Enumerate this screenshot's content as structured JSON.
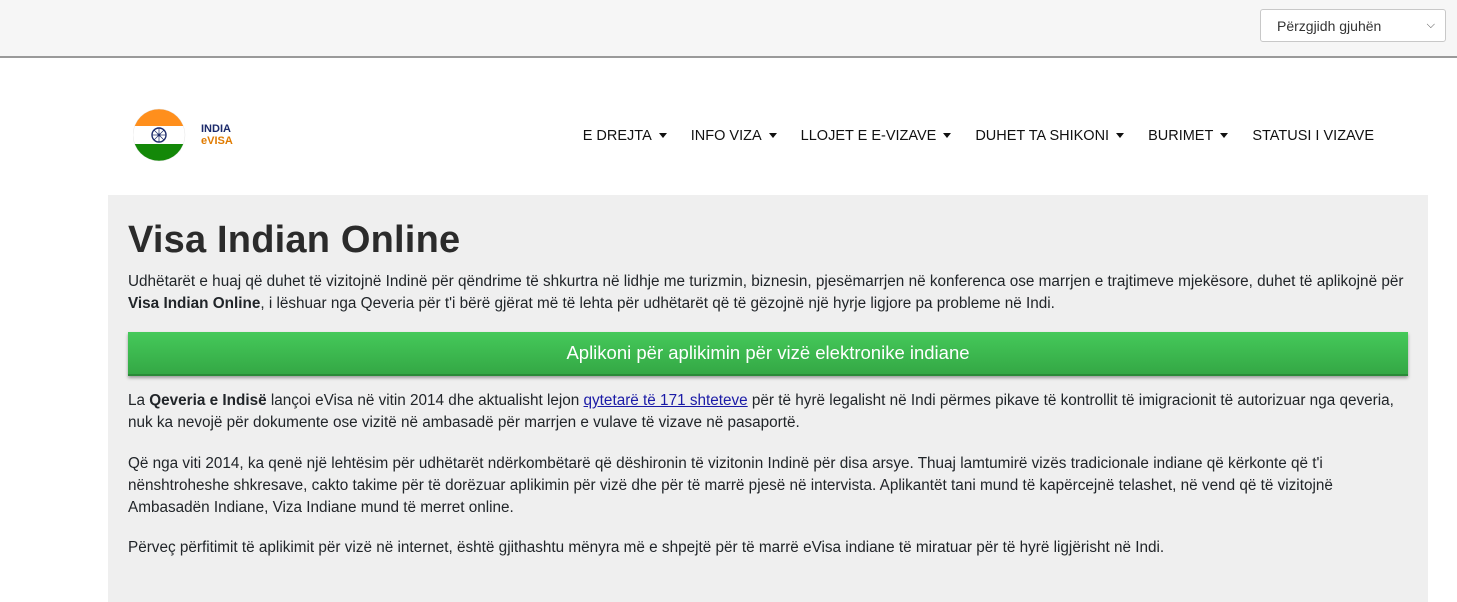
{
  "topbar": {
    "language_select": "Përzgjidh gjuhën"
  },
  "logo": {
    "line1": "INDIA",
    "line2": "eVISA",
    "flag_colors": {
      "saffron": "#ff8f1c",
      "white": "#ffffff",
      "green": "#138808",
      "chakra": "#1c2b6b"
    }
  },
  "nav": {
    "items": [
      {
        "label": "E DREJTA",
        "dropdown": true
      },
      {
        "label": "INFO VIZA",
        "dropdown": true
      },
      {
        "label": "LLOJET E E-VIZAVE",
        "dropdown": true
      },
      {
        "label": "DUHET TA SHIKONI",
        "dropdown": true
      },
      {
        "label": "BURIMET",
        "dropdown": true
      },
      {
        "label": "STATUSI I VIZAVE",
        "dropdown": false
      }
    ]
  },
  "main": {
    "title": "Visa Indian Online",
    "p1_before": "Udhëtarët e huaj që duhet të vizitojnë Indinë për qëndrime të shkurtra në lidhje me turizmin, biznesin, pjesëmarrjen në konferenca ose marrjen e trajtimeve mjekësore, duhet të aplikojnë për ",
    "p1_bold": "Visa Indian Online",
    "p1_after": ", i lëshuar nga Qeveria për t'i bërë gjërat më të lehta për udhëtarët që të gëzojnë një hyrje ligjore pa probleme në Indi.",
    "cta_label": "Aplikoni për aplikimin për vizë elektronike indiane",
    "p2_before": "La ",
    "p2_bold": "Qeveria e Indisë",
    "p2_mid": " lançoi eVisa në vitin 2014 dhe aktualisht lejon ",
    "p2_link": "qytetarë të 171 shteteve",
    "p2_after": " për të hyrë legalisht në Indi përmes pikave të kontrollit të imigracionit të autorizuar nga qeveria, nuk ka nevojë për dokumente ose vizitë në ambasadë për marrjen e vulave të vizave në pasaportë.",
    "p3": "Që nga viti 2014, ka qenë një lehtësim për udhëtarët ndërkombëtarë që dëshironin të vizitonin Indinë për disa arsye. Thuaj lamtumirë vizës tradicionale indiane që kërkonte që t'i nënshtroheshe shkresave, cakto takime për të dorëzuar aplikimin për vizë dhe për të marrë pjesë në intervista. Aplikantët tani mund të kapërcejnë telashet, në vend që të vizitojnë Ambasadën Indiane, Viza Indiane mund të merret online.",
    "p4": "Përveç përfitimit të aplikimit për vizë në internet, është gjithashtu mënyra më e shpejtë për të marrë eVisa indiane të miratuar për të hyrë ligjërisht në Indi."
  }
}
